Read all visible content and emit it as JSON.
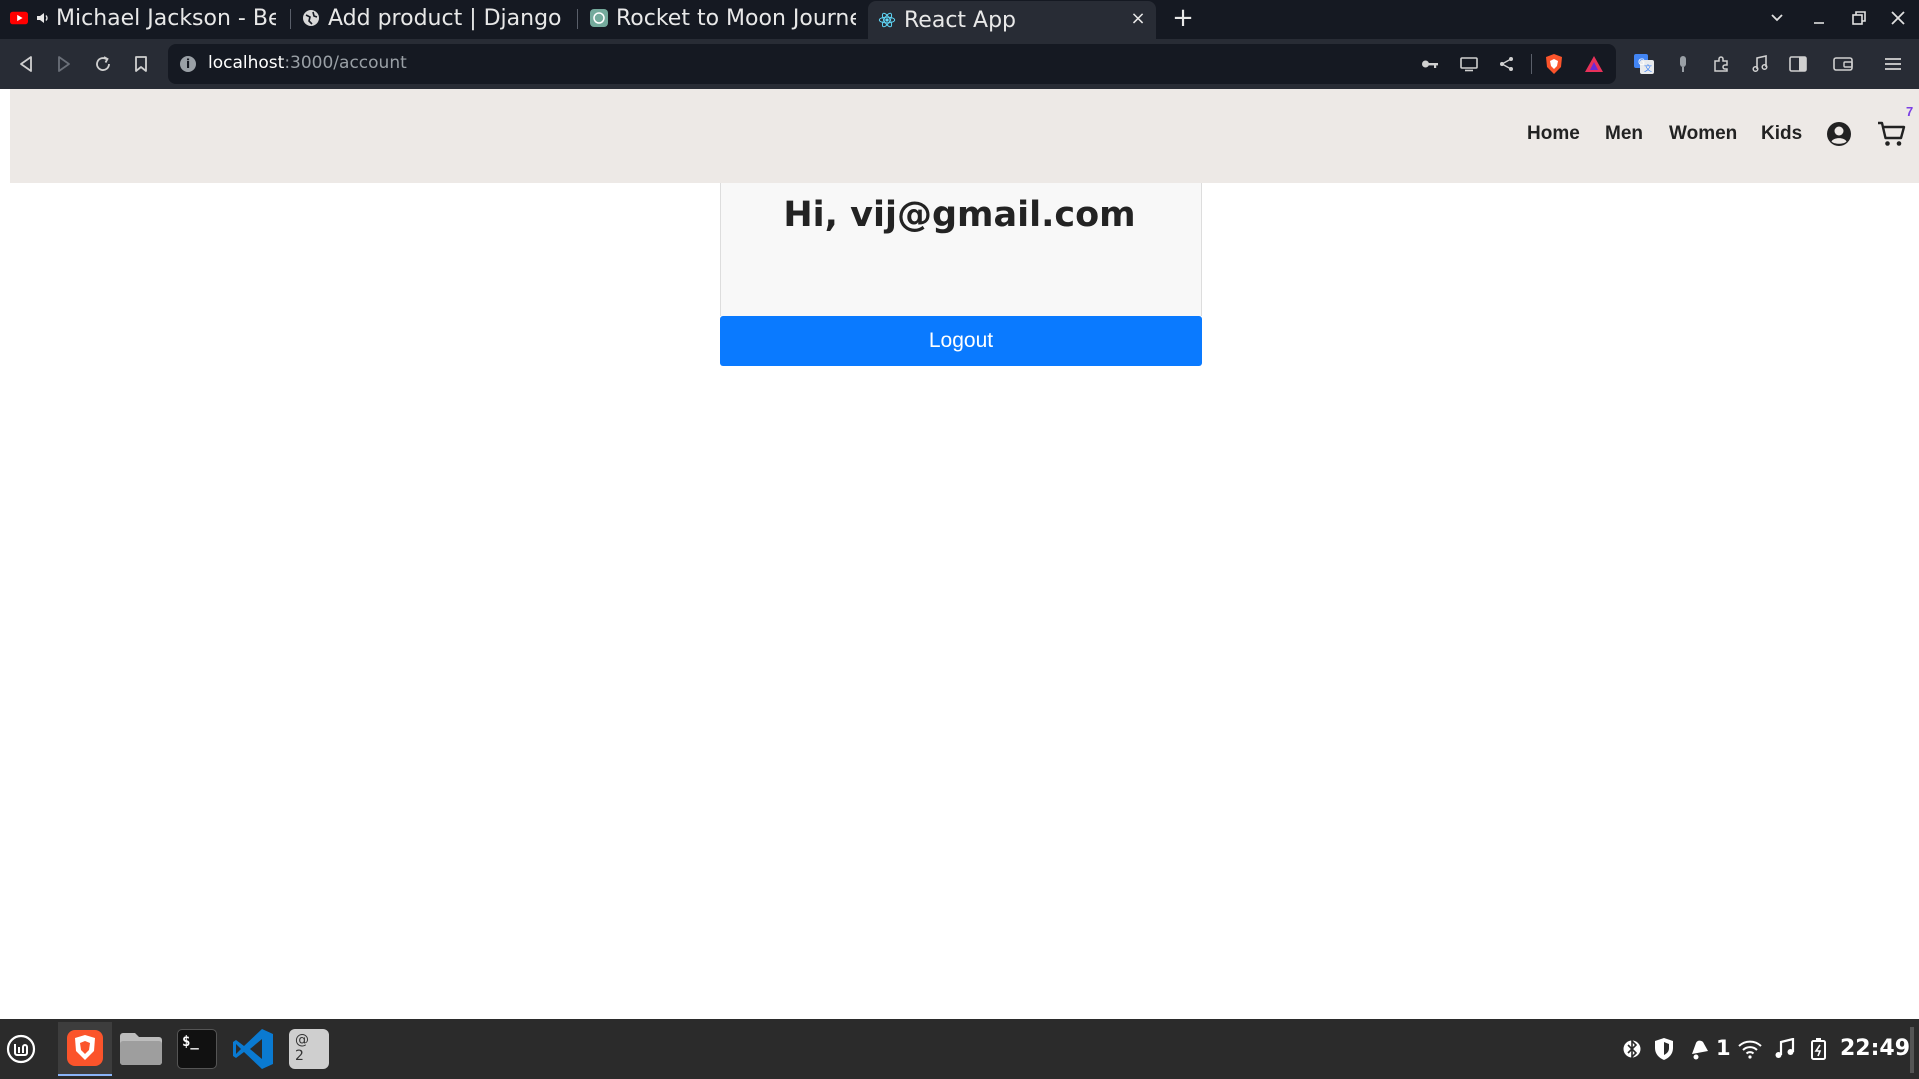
{
  "browser": {
    "tabs": [
      {
        "title": "Michael Jackson - Beat It",
        "favicon": "youtube-icon",
        "audio": true
      },
      {
        "title": "Add product | Django site admin",
        "favicon": "globe-icon"
      },
      {
        "title": "Rocket to Moon Journey",
        "favicon": "chatgpt-icon"
      },
      {
        "title": "React App",
        "favicon": "react-icon",
        "active": true
      }
    ],
    "new_tab": "+",
    "close_tab": "×",
    "url_host": "localhost",
    "url_rest": ":3000/account",
    "colors": {
      "tab_bar": "#151922",
      "toolbar": "#282c35",
      "brave_orange": "#fb542b"
    }
  },
  "site": {
    "nav": {
      "links": [
        "Home",
        "Men",
        "Women",
        "Kids"
      ],
      "cart_count": "7"
    },
    "account": {
      "greeting": "Hi, vij@gmail.com",
      "logout_label": "Logout"
    },
    "colors": {
      "nav_bg": "#ede9e6",
      "button": "#0a7aff",
      "cart_badge": "#7b3fe4"
    }
  },
  "taskbar": {
    "workspace_badge": "@\n2",
    "terminal_label": "$_",
    "notification_count": "1",
    "clock": "22:49"
  }
}
